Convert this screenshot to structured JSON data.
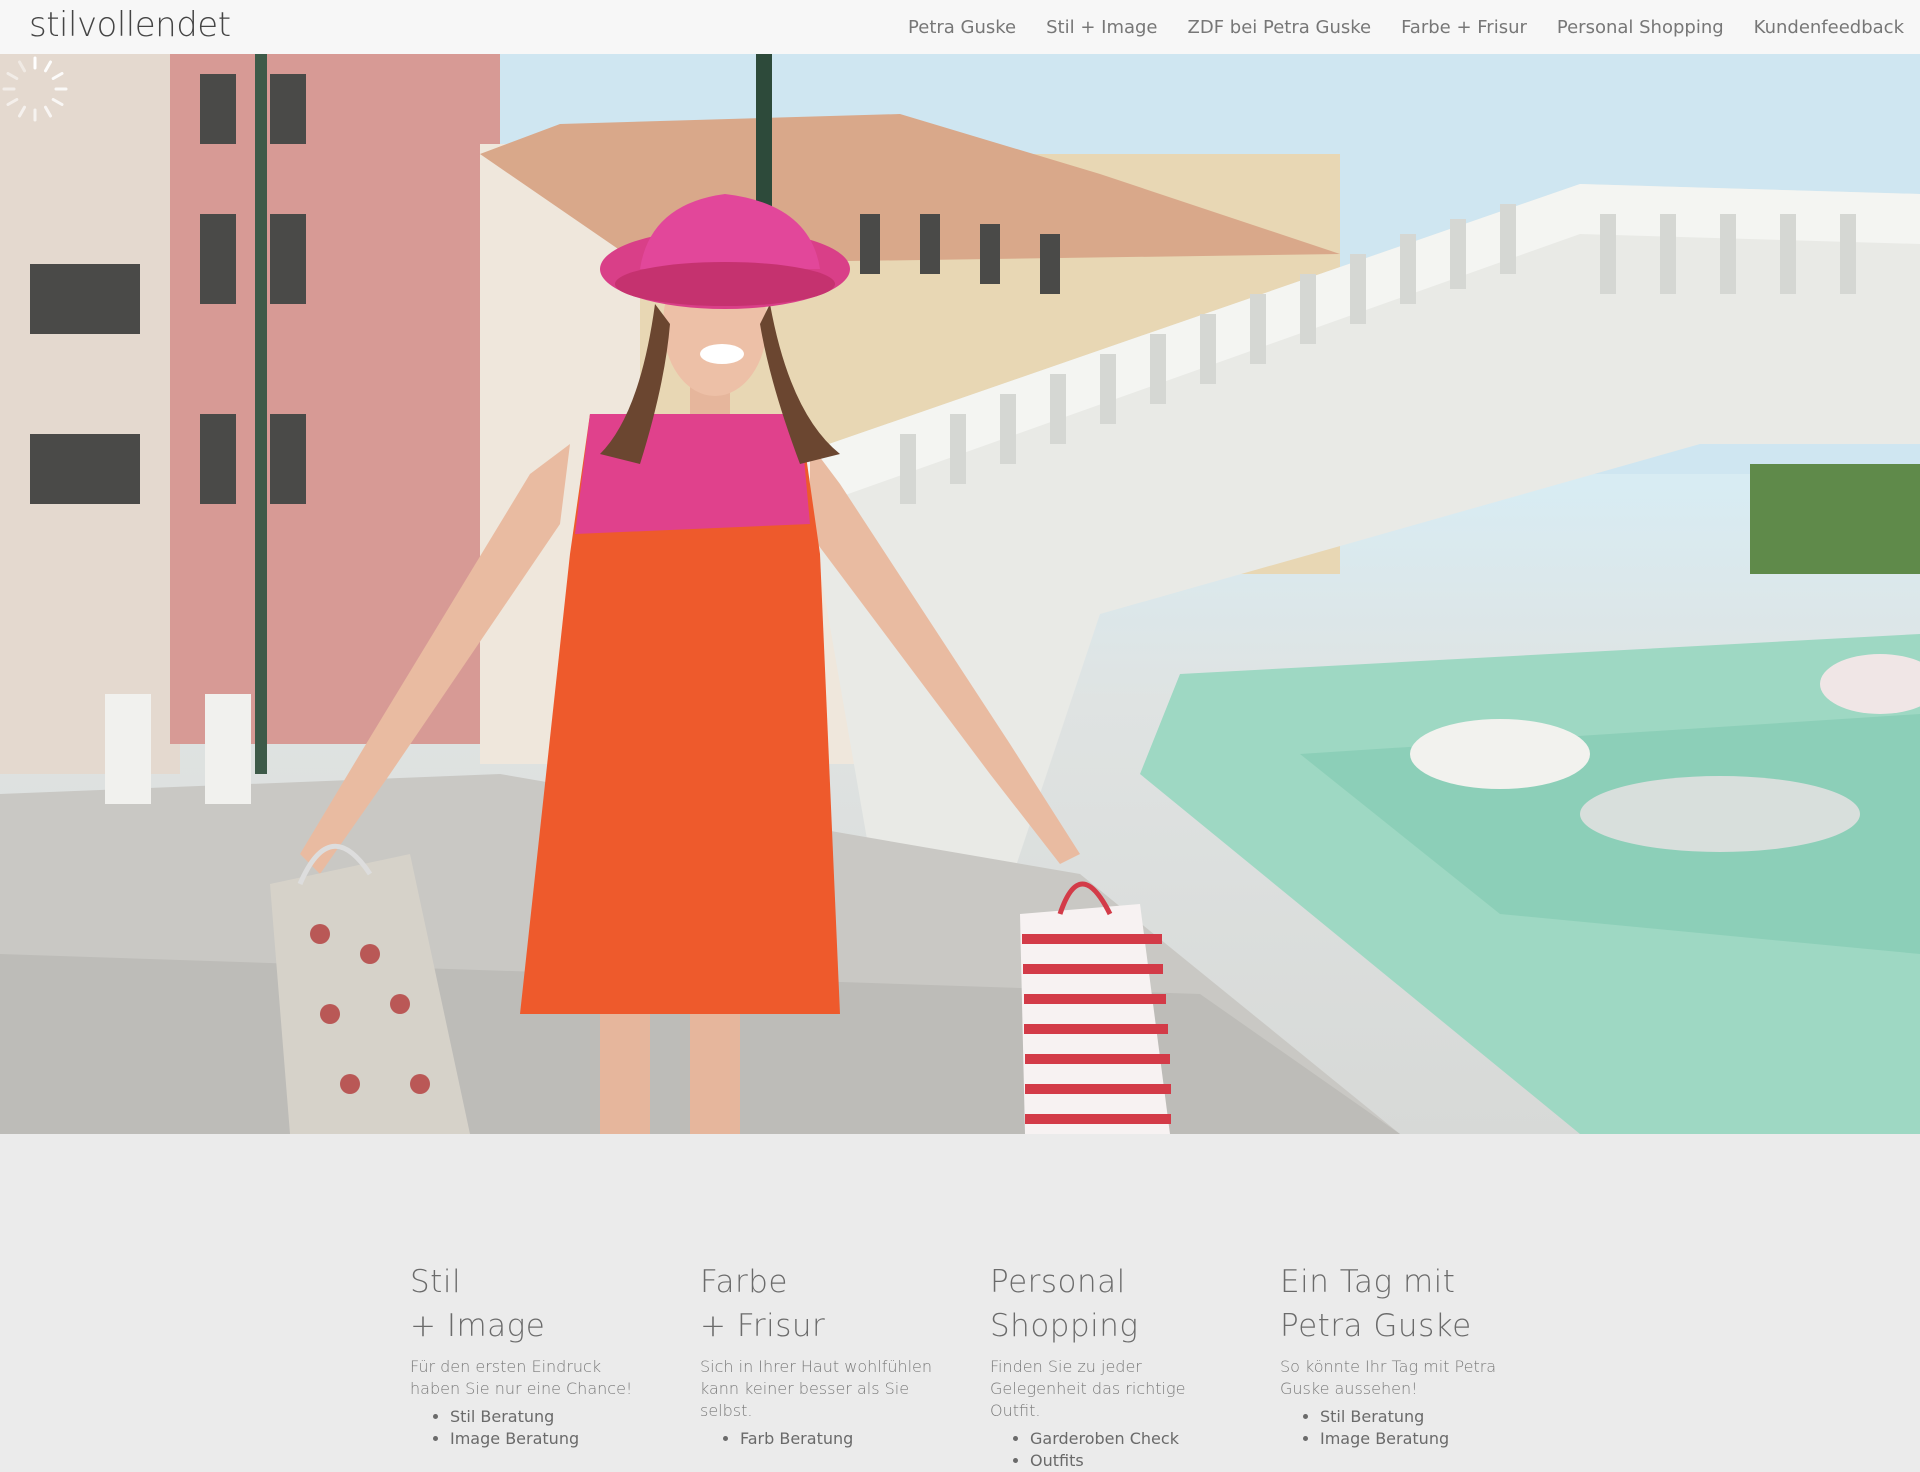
{
  "header": {
    "logo": "stilvollendet",
    "nav": [
      {
        "label": "Petra Guske"
      },
      {
        "label": "Stil + Image"
      },
      {
        "label": "ZDF bei Petra Guske"
      },
      {
        "label": "Farbe + Frisur"
      },
      {
        "label": "Personal Shopping"
      },
      {
        "label": "Kundenfeedback"
      }
    ]
  },
  "hero": {
    "image": "woman-in-hat-with-shopping-bags-venice-photo",
    "loading_indicator": "loading-spinner"
  },
  "features": [
    {
      "title_line1": "Stil",
      "title_line2": "+ Image",
      "text": "Für den ersten Eindruck haben Sie nur eine Chance!",
      "items": [
        "Stil Beratung",
        "Image Beratung"
      ]
    },
    {
      "title_line1": "Farbe",
      "title_line2": "+ Frisur",
      "text": "Sich in Ihrer Haut wohlfühlen kann keiner besser als Sie selbst.",
      "items": [
        "Farb Beratung"
      ]
    },
    {
      "title_line1": "Personal",
      "title_line2": "Shopping",
      "text": "Finden Sie zu jeder Gelegenheit das richtige Outfit.",
      "items": [
        "Garderoben Check",
        "Outfits"
      ]
    },
    {
      "title_line1": "Ein Tag mit",
      "title_line2": "Petra Guske",
      "text": "So könnte Ihr Tag mit Petra Guske aussehen!",
      "items": [
        "Stil Beratung",
        "Image Beratung"
      ]
    }
  ]
}
